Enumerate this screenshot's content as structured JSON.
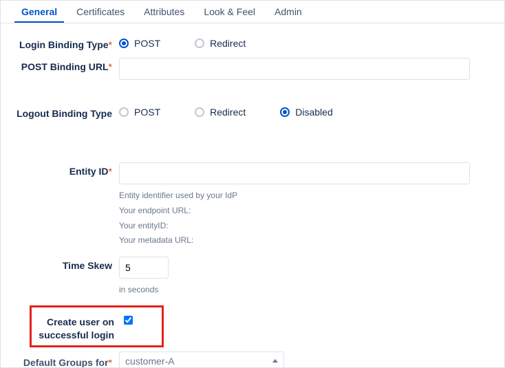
{
  "tabs": {
    "general": "General",
    "certificates": "Certificates",
    "attributes": "Attributes",
    "lookfeel": "Look & Feel",
    "admin": "Admin"
  },
  "loginBinding": {
    "label": "Login Binding Type",
    "post": "POST",
    "redirect": "Redirect"
  },
  "postBindingUrl": {
    "label": "POST Binding URL",
    "value": ""
  },
  "logoutBinding": {
    "label": "Logout Binding Type",
    "post": "POST",
    "redirect": "Redirect",
    "disabled": "Disabled"
  },
  "entityId": {
    "label": "Entity ID",
    "value": "",
    "help1": "Entity identifier used by your IdP",
    "help2": "Your endpoint URL:",
    "help3": "Your entityID:",
    "help4": "Your metadata URL:"
  },
  "timeSkew": {
    "label": "Time Skew",
    "value": "5",
    "help": "in seconds"
  },
  "createUser": {
    "label": "Create user on successful login",
    "checked": true
  },
  "defaultGroups": {
    "label": "Default Groups for",
    "value": "customer-A"
  }
}
